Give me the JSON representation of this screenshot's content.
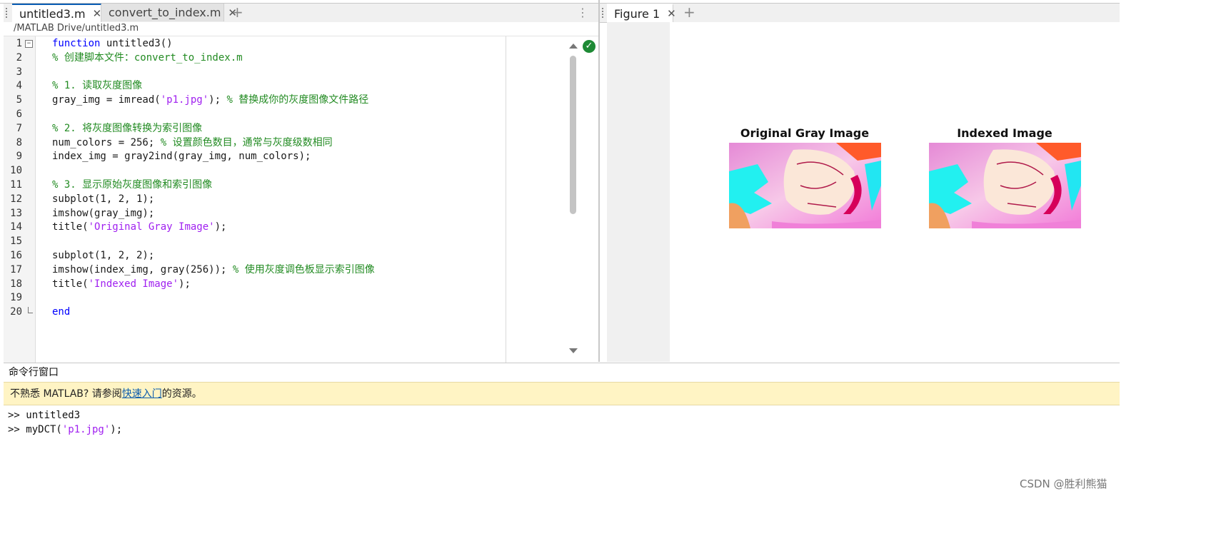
{
  "editor": {
    "tabs": [
      {
        "label": "untitled3.m",
        "active": true
      },
      {
        "label": "convert_to_index.m",
        "active": false
      }
    ],
    "path": "/MATLAB Drive/untitled3.m",
    "lines": [
      {
        "n": "1",
        "parts": [
          {
            "t": "function",
            "c": "kw"
          },
          {
            "t": " untitled3()",
            "c": ""
          }
        ]
      },
      {
        "n": "2",
        "parts": [
          {
            "t": "% 创建脚本文件：convert_to_index.m",
            "c": "cm"
          }
        ]
      },
      {
        "n": "3",
        "parts": []
      },
      {
        "n": "4",
        "parts": [
          {
            "t": "% 1. 读取灰度图像",
            "c": "cm"
          }
        ]
      },
      {
        "n": "5",
        "parts": [
          {
            "t": "gray_img = imread(",
            "c": ""
          },
          {
            "t": "'p1.jpg'",
            "c": "str"
          },
          {
            "t": "); ",
            "c": ""
          },
          {
            "t": "% 替换成你的灰度图像文件路径",
            "c": "cm"
          }
        ]
      },
      {
        "n": "6",
        "parts": []
      },
      {
        "n": "7",
        "parts": [
          {
            "t": "% 2. 将灰度图像转换为索引图像",
            "c": "cm"
          }
        ]
      },
      {
        "n": "8",
        "parts": [
          {
            "t": "num_colors = 256; ",
            "c": ""
          },
          {
            "t": "% 设置颜色数目，通常与灰度级数相同",
            "c": "cm"
          }
        ]
      },
      {
        "n": "9",
        "parts": [
          {
            "t": "index_img = gray2ind(gray_img, num_colors);",
            "c": ""
          }
        ]
      },
      {
        "n": "10",
        "parts": []
      },
      {
        "n": "11",
        "parts": [
          {
            "t": "% 3. 显示原始灰度图像和索引图像",
            "c": "cm"
          }
        ]
      },
      {
        "n": "12",
        "parts": [
          {
            "t": "subplot(1, 2, 1);",
            "c": ""
          }
        ]
      },
      {
        "n": "13",
        "parts": [
          {
            "t": "imshow(gray_img);",
            "c": ""
          }
        ]
      },
      {
        "n": "14",
        "parts": [
          {
            "t": "title(",
            "c": ""
          },
          {
            "t": "'Original Gray Image'",
            "c": "str"
          },
          {
            "t": ");",
            "c": ""
          }
        ]
      },
      {
        "n": "15",
        "parts": []
      },
      {
        "n": "16",
        "parts": [
          {
            "t": "subplot(1, 2, 2);",
            "c": ""
          }
        ]
      },
      {
        "n": "17",
        "parts": [
          {
            "t": "imshow(index_img, gray(256)); ",
            "c": ""
          },
          {
            "t": "% 使用灰度调色板显示索引图像",
            "c": "cm"
          }
        ]
      },
      {
        "n": "18",
        "parts": [
          {
            "t": "title(",
            "c": ""
          },
          {
            "t": "'Indexed Image'",
            "c": "str"
          },
          {
            "t": ");",
            "c": ""
          }
        ]
      },
      {
        "n": "19",
        "parts": []
      },
      {
        "n": "20",
        "parts": [
          {
            "t": "end",
            "c": "kw"
          }
        ]
      }
    ]
  },
  "figure": {
    "tab_label": "Figure 1",
    "axes": [
      {
        "title": "Original Gray Image"
      },
      {
        "title": "Indexed Image"
      }
    ]
  },
  "command_window": {
    "header": "命令行窗口",
    "notice_prefix": "不熟悉 MATLAB? 请参阅",
    "notice_link": "快速入门",
    "notice_suffix": "的资源。",
    "history": [
      {
        "parts": [
          {
            "t": ">> untitled3",
            "c": ""
          }
        ]
      },
      {
        "parts": [
          {
            "t": ">> myDCT(",
            "c": ""
          },
          {
            "t": "'p1.jpg'",
            "c": "str"
          },
          {
            "t": ");",
            "c": ""
          }
        ]
      }
    ]
  },
  "watermark": "CSDN @胜利熊猫",
  "colors": {
    "keyword": "#0000ff",
    "comment": "#228b22",
    "string": "#a020f0",
    "accent": "#0a5db4",
    "notice_bg": "#fff4c4"
  }
}
